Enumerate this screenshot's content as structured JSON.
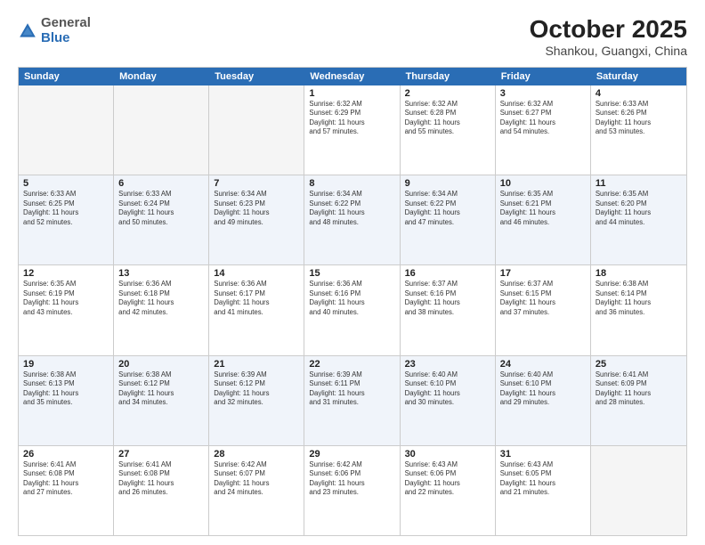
{
  "header": {
    "logo_general": "General",
    "logo_blue": "Blue",
    "month_year": "October 2025",
    "location": "Shankou, Guangxi, China"
  },
  "weekdays": [
    "Sunday",
    "Monday",
    "Tuesday",
    "Wednesday",
    "Thursday",
    "Friday",
    "Saturday"
  ],
  "rows": [
    [
      {
        "day": "",
        "text": "",
        "empty": true
      },
      {
        "day": "",
        "text": "",
        "empty": true
      },
      {
        "day": "",
        "text": "",
        "empty": true
      },
      {
        "day": "1",
        "text": "Sunrise: 6:32 AM\nSunset: 6:29 PM\nDaylight: 11 hours\nand 57 minutes."
      },
      {
        "day": "2",
        "text": "Sunrise: 6:32 AM\nSunset: 6:28 PM\nDaylight: 11 hours\nand 55 minutes."
      },
      {
        "day": "3",
        "text": "Sunrise: 6:32 AM\nSunset: 6:27 PM\nDaylight: 11 hours\nand 54 minutes."
      },
      {
        "day": "4",
        "text": "Sunrise: 6:33 AM\nSunset: 6:26 PM\nDaylight: 11 hours\nand 53 minutes."
      }
    ],
    [
      {
        "day": "5",
        "text": "Sunrise: 6:33 AM\nSunset: 6:25 PM\nDaylight: 11 hours\nand 52 minutes."
      },
      {
        "day": "6",
        "text": "Sunrise: 6:33 AM\nSunset: 6:24 PM\nDaylight: 11 hours\nand 50 minutes."
      },
      {
        "day": "7",
        "text": "Sunrise: 6:34 AM\nSunset: 6:23 PM\nDaylight: 11 hours\nand 49 minutes."
      },
      {
        "day": "8",
        "text": "Sunrise: 6:34 AM\nSunset: 6:22 PM\nDaylight: 11 hours\nand 48 minutes."
      },
      {
        "day": "9",
        "text": "Sunrise: 6:34 AM\nSunset: 6:22 PM\nDaylight: 11 hours\nand 47 minutes."
      },
      {
        "day": "10",
        "text": "Sunrise: 6:35 AM\nSunset: 6:21 PM\nDaylight: 11 hours\nand 46 minutes."
      },
      {
        "day": "11",
        "text": "Sunrise: 6:35 AM\nSunset: 6:20 PM\nDaylight: 11 hours\nand 44 minutes."
      }
    ],
    [
      {
        "day": "12",
        "text": "Sunrise: 6:35 AM\nSunset: 6:19 PM\nDaylight: 11 hours\nand 43 minutes."
      },
      {
        "day": "13",
        "text": "Sunrise: 6:36 AM\nSunset: 6:18 PM\nDaylight: 11 hours\nand 42 minutes."
      },
      {
        "day": "14",
        "text": "Sunrise: 6:36 AM\nSunset: 6:17 PM\nDaylight: 11 hours\nand 41 minutes."
      },
      {
        "day": "15",
        "text": "Sunrise: 6:36 AM\nSunset: 6:16 PM\nDaylight: 11 hours\nand 40 minutes."
      },
      {
        "day": "16",
        "text": "Sunrise: 6:37 AM\nSunset: 6:16 PM\nDaylight: 11 hours\nand 38 minutes."
      },
      {
        "day": "17",
        "text": "Sunrise: 6:37 AM\nSunset: 6:15 PM\nDaylight: 11 hours\nand 37 minutes."
      },
      {
        "day": "18",
        "text": "Sunrise: 6:38 AM\nSunset: 6:14 PM\nDaylight: 11 hours\nand 36 minutes."
      }
    ],
    [
      {
        "day": "19",
        "text": "Sunrise: 6:38 AM\nSunset: 6:13 PM\nDaylight: 11 hours\nand 35 minutes."
      },
      {
        "day": "20",
        "text": "Sunrise: 6:38 AM\nSunset: 6:12 PM\nDaylight: 11 hours\nand 34 minutes."
      },
      {
        "day": "21",
        "text": "Sunrise: 6:39 AM\nSunset: 6:12 PM\nDaylight: 11 hours\nand 32 minutes."
      },
      {
        "day": "22",
        "text": "Sunrise: 6:39 AM\nSunset: 6:11 PM\nDaylight: 11 hours\nand 31 minutes."
      },
      {
        "day": "23",
        "text": "Sunrise: 6:40 AM\nSunset: 6:10 PM\nDaylight: 11 hours\nand 30 minutes."
      },
      {
        "day": "24",
        "text": "Sunrise: 6:40 AM\nSunset: 6:10 PM\nDaylight: 11 hours\nand 29 minutes."
      },
      {
        "day": "25",
        "text": "Sunrise: 6:41 AM\nSunset: 6:09 PM\nDaylight: 11 hours\nand 28 minutes."
      }
    ],
    [
      {
        "day": "26",
        "text": "Sunrise: 6:41 AM\nSunset: 6:08 PM\nDaylight: 11 hours\nand 27 minutes."
      },
      {
        "day": "27",
        "text": "Sunrise: 6:41 AM\nSunset: 6:08 PM\nDaylight: 11 hours\nand 26 minutes."
      },
      {
        "day": "28",
        "text": "Sunrise: 6:42 AM\nSunset: 6:07 PM\nDaylight: 11 hours\nand 24 minutes."
      },
      {
        "day": "29",
        "text": "Sunrise: 6:42 AM\nSunset: 6:06 PM\nDaylight: 11 hours\nand 23 minutes."
      },
      {
        "day": "30",
        "text": "Sunrise: 6:43 AM\nSunset: 6:06 PM\nDaylight: 11 hours\nand 22 minutes."
      },
      {
        "day": "31",
        "text": "Sunrise: 6:43 AM\nSunset: 6:05 PM\nDaylight: 11 hours\nand 21 minutes."
      },
      {
        "day": "",
        "text": "",
        "empty": true
      }
    ]
  ]
}
